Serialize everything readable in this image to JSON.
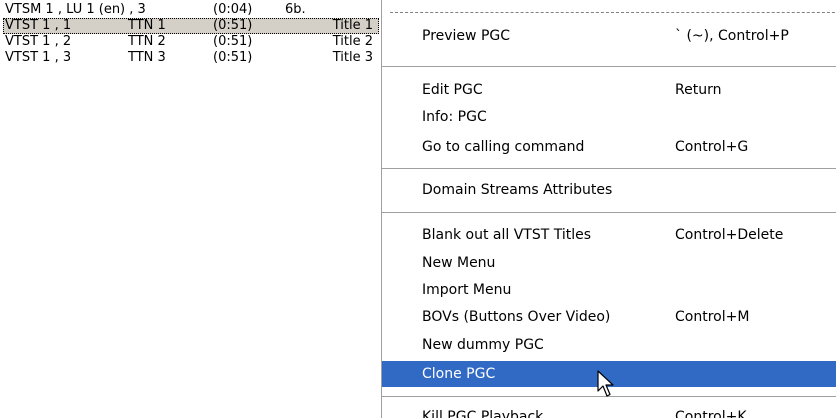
{
  "pgc_list": {
    "header_row": {
      "col1": "VTSM 1 , LU 1 (en) , 3",
      "col2": "(0:04)",
      "col3": "6b."
    },
    "rows": [
      {
        "col1": "VTST 1 , 1",
        "col2": "TTN 1",
        "col3": "(0:51)",
        "col4": "Title 1"
      },
      {
        "col1": "VTST 1 , 2",
        "col2": "TTN 2",
        "col3": "(0:51)",
        "col4": "Title 2"
      },
      {
        "col1": "VTST 1 , 3",
        "col2": "TTN 3",
        "col3": "(0:51)",
        "col4": "Title 3"
      }
    ]
  },
  "context_menu": {
    "items": [
      {
        "label": "Preview PGC",
        "shortcut": "` (~), Control+P"
      },
      {
        "label": "Edit PGC",
        "shortcut": "Return"
      },
      {
        "label": "Info: PGC",
        "shortcut": ""
      },
      {
        "label": "Go to calling command",
        "shortcut": "Control+G"
      },
      {
        "label": "Domain Streams Attributes",
        "shortcut": ""
      },
      {
        "label": "Blank out all VTST Titles",
        "shortcut": "Control+Delete"
      },
      {
        "label": "New Menu",
        "shortcut": ""
      },
      {
        "label": "Import Menu",
        "shortcut": ""
      },
      {
        "label": "BOVs (Buttons Over Video)",
        "shortcut": "Control+M"
      },
      {
        "label": "New dummy PGC",
        "shortcut": ""
      },
      {
        "label": "Clone PGC",
        "shortcut": ""
      },
      {
        "label": "Kill PGC Playback",
        "shortcut": "Control+K"
      }
    ],
    "highlighted_item": "Clone PGC"
  },
  "colors": {
    "highlight": "#316ac5",
    "selected_row": "#d4d0c8"
  }
}
